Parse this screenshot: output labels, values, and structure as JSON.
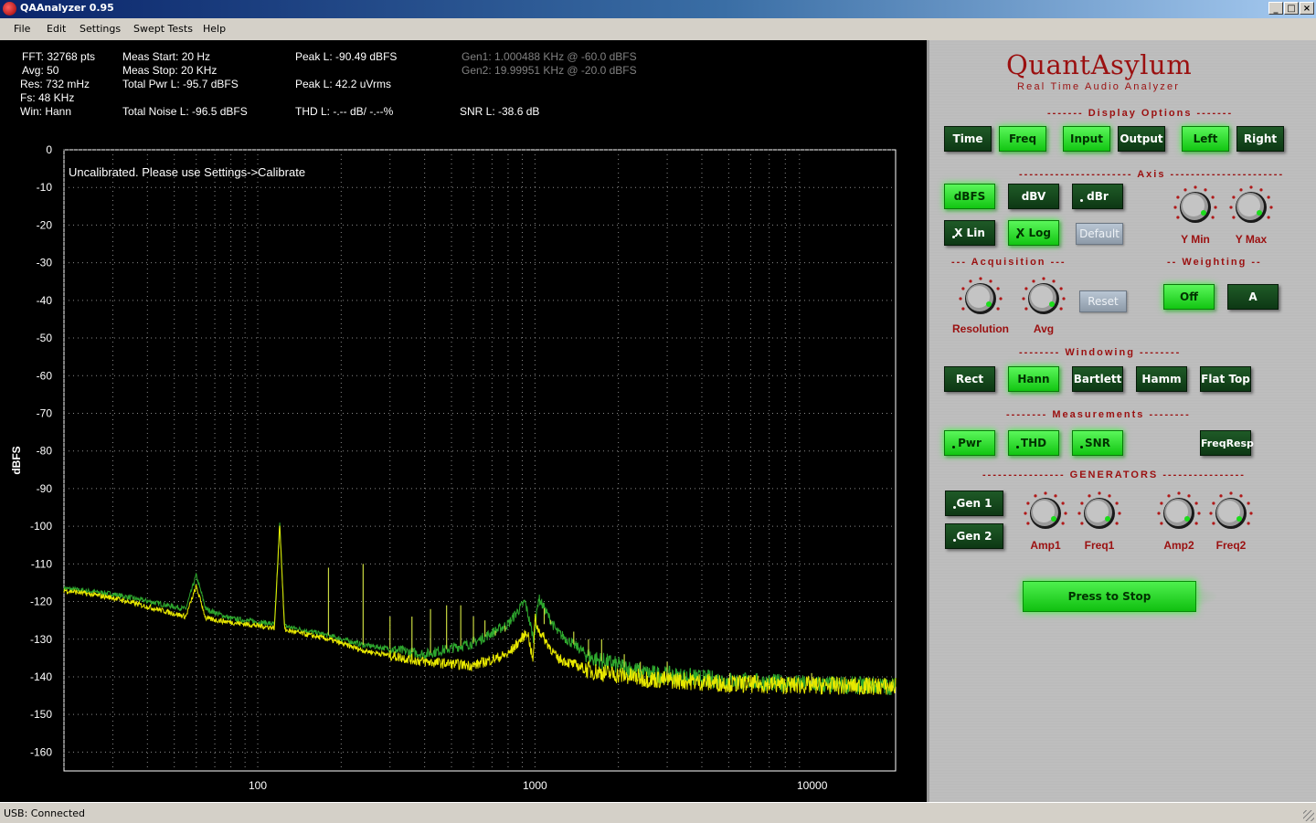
{
  "window": {
    "title": "QAAnalyzer 0.95"
  },
  "menu": [
    "File",
    "Edit",
    "Settings",
    "Swept Tests",
    "Help"
  ],
  "readouts": {
    "fft": "FFT: 32768 pts",
    "avg": "Avg: 50",
    "res": "Res: 732 mHz",
    "fs": "Fs: 48 KHz",
    "win": "Win: Hann",
    "meas_start": "Meas Start: 20 Hz",
    "meas_stop": "Meas Stop: 20 KHz",
    "total_pwr": "Total Pwr L: -95.7 dBFS",
    "total_noise": "Total Noise L: -96.5 dBFS",
    "peak_dbfs": "Peak L: -90.49 dBFS",
    "peak_vrms": "Peak L: 42.2 uVrms",
    "thd": "THD L: -.-- dB/ -.--%",
    "gen1": "Gen1: 1.000488 KHz @ -60.0 dBFS",
    "gen2": "Gen2: 19.99951 KHz @ -20.0 dBFS",
    "snr": "SNR L: -38.6 dB"
  },
  "chart_data": {
    "type": "line",
    "ylabel": "dBFS",
    "xlabel": "",
    "x_scale": "log",
    "xlim": [
      20,
      20000
    ],
    "ylim": [
      -165,
      0
    ],
    "y_ticks": [
      0,
      -10,
      -20,
      -30,
      -40,
      -50,
      -60,
      -70,
      -80,
      -90,
      -100,
      -110,
      -120,
      -130,
      -140,
      -150,
      -160
    ],
    "x_ticks": [
      100,
      1000,
      10000
    ],
    "grid": true,
    "annotation": "Uncalibrated. Please use Settings->Calibrate",
    "series": [
      {
        "color": "#e8e800",
        "points": [
          [
            20,
            -117
          ],
          [
            30,
            -119
          ],
          [
            55,
            -124
          ],
          [
            60,
            -116
          ],
          [
            65,
            -124.5
          ],
          [
            80,
            -125.5
          ],
          [
            115,
            -127
          ],
          [
            120,
            -99
          ],
          [
            125,
            -127.5
          ],
          [
            180,
            -130
          ],
          [
            240,
            -133
          ],
          [
            400,
            -136
          ],
          [
            600,
            -137
          ],
          [
            800,
            -134
          ],
          [
            940,
            -128
          ],
          [
            985,
            -136
          ],
          [
            1000,
            -124
          ],
          [
            1020,
            -127
          ],
          [
            1200,
            -135
          ],
          [
            1600,
            -138.5
          ],
          [
            2500,
            -140.5
          ],
          [
            5000,
            -141.8
          ],
          [
            10000,
            -142.3
          ],
          [
            20000,
            -142.6
          ]
        ]
      },
      {
        "color": "#2ea82e",
        "points": [
          [
            20,
            -116.5
          ],
          [
            30,
            -118
          ],
          [
            55,
            -122
          ],
          [
            60,
            -113
          ],
          [
            65,
            -122
          ],
          [
            80,
            -124.5
          ],
          [
            115,
            -126
          ],
          [
            120,
            -99
          ],
          [
            125,
            -126.5
          ],
          [
            180,
            -129
          ],
          [
            240,
            -131.5
          ],
          [
            400,
            -134
          ],
          [
            600,
            -131
          ],
          [
            800,
            -126
          ],
          [
            920,
            -120
          ],
          [
            990,
            -130
          ],
          [
            1030,
            -119
          ],
          [
            1200,
            -128
          ],
          [
            1600,
            -135
          ],
          [
            2500,
            -139
          ],
          [
            5000,
            -141
          ],
          [
            10000,
            -142
          ],
          [
            20000,
            -142.5
          ]
        ]
      }
    ],
    "harmonics": [
      [
        120,
        -99
      ],
      [
        180,
        -111
      ],
      [
        240,
        -110
      ],
      [
        300,
        -124
      ],
      [
        360,
        -124
      ],
      [
        420,
        -122
      ],
      [
        480,
        -121
      ],
      [
        540,
        -121
      ],
      [
        600,
        -124
      ],
      [
        660,
        -125
      ],
      [
        720,
        -129
      ],
      [
        780,
        -128
      ],
      [
        1080,
        -126
      ],
      [
        1140,
        -126
      ],
      [
        1200,
        -128
      ],
      [
        1380,
        -128
      ],
      [
        1560,
        -130
      ],
      [
        1740,
        -130
      ],
      [
        2100,
        -134
      ],
      [
        2400,
        -136
      ],
      [
        3000,
        -136
      ],
      [
        5040,
        -139
      ],
      [
        9960,
        -139
      ]
    ]
  },
  "panel": {
    "brand": "QuantAsylum",
    "tagline": "Real Time Audio Analyzer",
    "sections": {
      "display": "------- Display Options -------",
      "axis": "---------------------- Axis ----------------------",
      "acq": "--- Acquisition ---",
      "weighting": "-- Weighting --",
      "windowing": "-------- Windowing --------",
      "measurements": "-------- Measurements --------",
      "generators": "---------------- GENERATORS ----------------"
    },
    "display": {
      "time": "Time",
      "freq": "Freq",
      "input": "Input",
      "output": "Output",
      "left": "Left",
      "right": "Right"
    },
    "axis": {
      "dbfs": "dBFS",
      "dbv": "dBV",
      "dbr": "dBr",
      "xlin": "X Lin",
      "xlog": "X Log",
      "default": "Default",
      "ymin": "Y Min",
      "ymax": "Y Max"
    },
    "acq": {
      "resolution": "Resolution",
      "avg": "Avg",
      "reset": "Reset"
    },
    "weighting": {
      "off": "Off",
      "a": "A"
    },
    "windowing": {
      "rect": "Rect",
      "hann": "Hann",
      "bartlett": "Bartlett",
      "hamm": "Hamm",
      "flattop": "Flat Top"
    },
    "measurements": {
      "pwr": "Pwr",
      "thd": "THD",
      "snr": "SNR",
      "freqresp": "FreqResp"
    },
    "generators": {
      "gen1": "Gen 1",
      "gen2": "Gen 2",
      "amp1": "Amp1",
      "freq1": "Freq1",
      "amp2": "Amp2",
      "freq2": "Freq2"
    },
    "stop": "Press to Stop"
  },
  "status": "USB: Connected"
}
